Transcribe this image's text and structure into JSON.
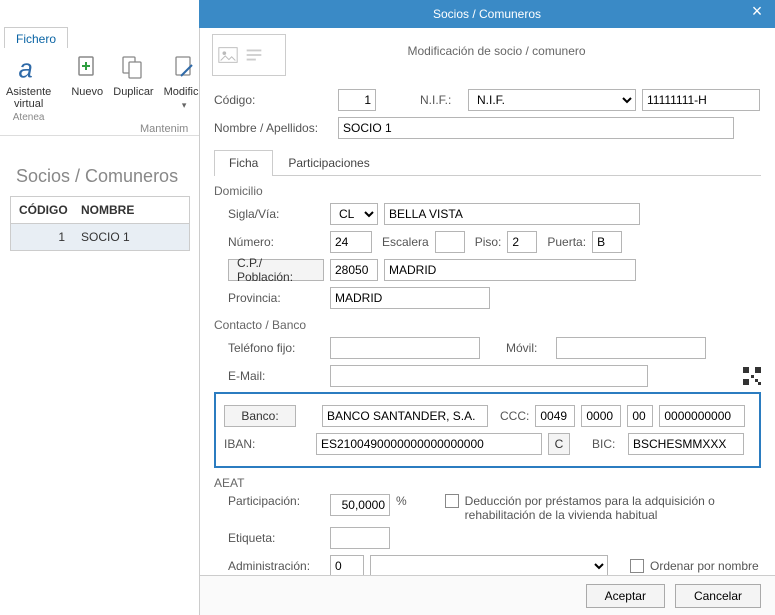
{
  "window": {
    "modal_title": "Socios / Comuneros",
    "subtitle": "Modificación de socio / comunero"
  },
  "background": {
    "ribbon_tab": "Fichero",
    "ribbon": {
      "asistente": "Asistente virtual",
      "atenea": "Atenea",
      "nuevo": "Nuevo",
      "duplicar": "Duplicar",
      "modificar": "Modifica",
      "group_label": "Mantenim"
    },
    "page_title": "Socios / Comuneros",
    "grid": {
      "headers": {
        "codigo": "CÓDIGO",
        "nombre": "NOMBRE"
      },
      "row": {
        "codigo": "1",
        "nombre": "SOCIO 1"
      }
    }
  },
  "form": {
    "codigo_label": "Código:",
    "codigo_value": "1",
    "nif_label": "N.I.F.:",
    "nif_select": "N.I.F.",
    "nif_value": "11111111-H",
    "nombre_label": "Nombre / Apellidos:",
    "nombre_value": "SOCIO 1"
  },
  "tabs": {
    "ficha": "Ficha",
    "participaciones": "Participaciones"
  },
  "domicilio": {
    "section": "Domicilio",
    "sigla_label": "Sigla/Vía:",
    "sigla_value": "CL",
    "via_value": "BELLA VISTA",
    "numero_label": "Número:",
    "numero_value": "24",
    "escalera_label": "Escalera",
    "escalera_value": "",
    "piso_label": "Piso:",
    "piso_value": "2",
    "puerta_label": "Puerta:",
    "puerta_value": "B",
    "cp_btn": "C.P./ Población:",
    "cp_value": "28050",
    "poblacion_value": "MADRID",
    "provincia_label": "Provincia:",
    "provincia_value": "MADRID"
  },
  "contacto": {
    "section": "Contacto / Banco",
    "tel_label": "Teléfono fijo:",
    "tel_value": "",
    "movil_label": "Móvil:",
    "movil_value": "",
    "email_label": "E-Mail:",
    "email_value": "",
    "banco_btn": "Banco:",
    "banco_value": "BANCO SANTANDER, S.A.",
    "ccc_label": "CCC:",
    "ccc1": "0049",
    "ccc2": "0000",
    "ccc3": "00",
    "ccc4": "0000000000",
    "iban_label": "IBAN:",
    "iban_value": "ES2100490000000000000000",
    "iban_btn": "C",
    "bic_label": "BIC:",
    "bic_value": "BSCHESMMXXX"
  },
  "aeat": {
    "section": "AEAT",
    "part_label": "Participación:",
    "part_value": "50,0000",
    "percent": "%",
    "deduccion_label": "Deducción por préstamos para la adquisición o rehabilitación de la vivienda habitual",
    "etiqueta_label": "Etiqueta:",
    "etiqueta_value": "",
    "admin_label": "Administración:",
    "admin_value": "0",
    "ordenar_label": "Ordenar por nombre"
  },
  "footer": {
    "aceptar": "Aceptar",
    "cancelar": "Cancelar"
  }
}
